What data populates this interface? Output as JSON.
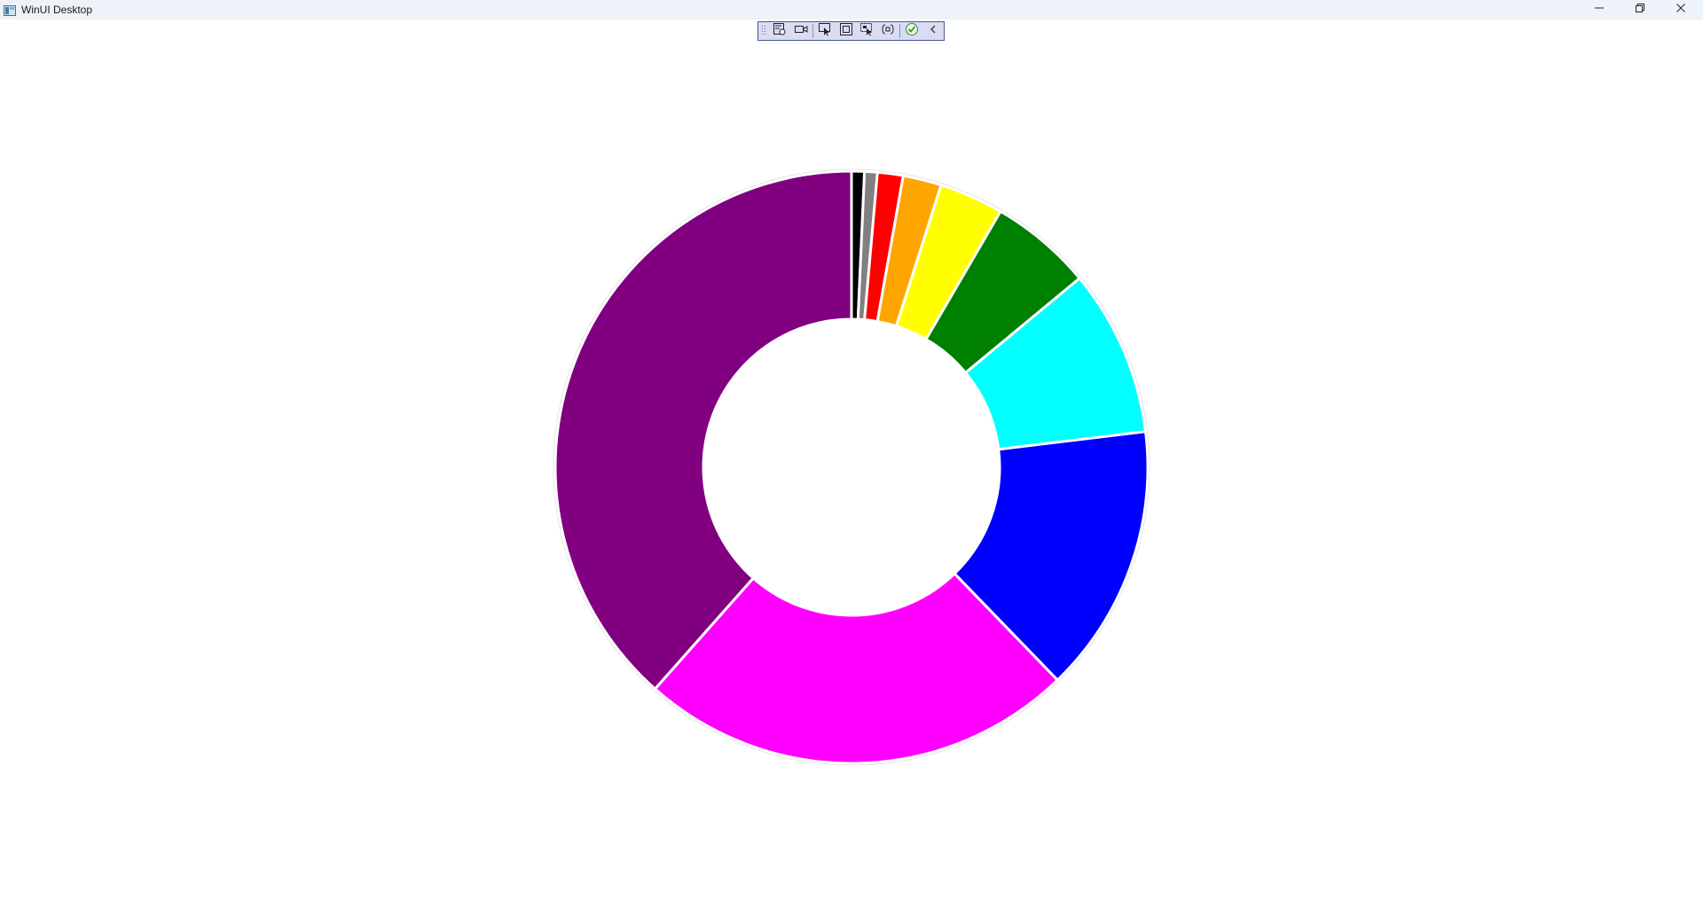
{
  "window": {
    "title": "WinUI Desktop"
  },
  "titlebar_icons": {
    "app": "app-window-icon",
    "minimize": "minimize-icon",
    "maximize": "restore-icon",
    "close": "close-icon"
  },
  "toolbar": {
    "items": [
      {
        "icon": "live-visual-tree-icon"
      },
      {
        "icon": "record-icon"
      },
      {
        "icon": "select-element-icon"
      },
      {
        "icon": "display-layout-adorners-icon"
      },
      {
        "icon": "track-focused-element-icon"
      },
      {
        "icon": "binding-failures-icon"
      },
      {
        "icon": "hot-reload-ok-icon"
      },
      {
        "icon": "collapse-toolbar-icon"
      }
    ]
  },
  "chart_data": {
    "type": "pie",
    "donut": true,
    "inner_radius_ratio": 0.5,
    "start_angle_deg": 0,
    "direction": "clockwise",
    "slice_stroke": "#ffffff",
    "slices": [
      {
        "value": 1,
        "color": "#000000"
      },
      {
        "value": 1,
        "color": "#808080"
      },
      {
        "value": 2,
        "color": "#ff0000"
      },
      {
        "value": 3,
        "color": "#ffa500"
      },
      {
        "value": 5,
        "color": "#ffff00"
      },
      {
        "value": 8,
        "color": "#008000"
      },
      {
        "value": 13,
        "color": "#00ffff"
      },
      {
        "value": 21,
        "color": "#0000ff"
      },
      {
        "value": 34,
        "color": "#ff00ff"
      },
      {
        "value": 55,
        "color": "#800080"
      }
    ]
  }
}
